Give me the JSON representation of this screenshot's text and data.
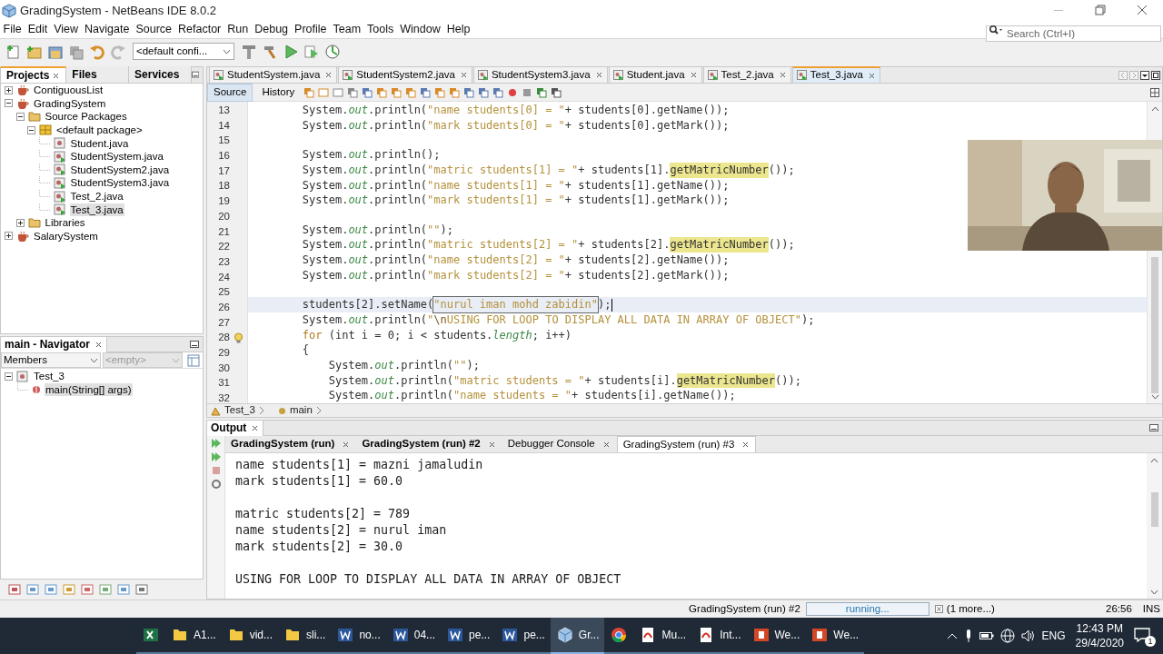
{
  "window": {
    "title": "GradingSystem - NetBeans IDE 8.0.2"
  },
  "menu": [
    "File",
    "Edit",
    "View",
    "Navigate",
    "Source",
    "Refactor",
    "Run",
    "Debug",
    "Profile",
    "Team",
    "Tools",
    "Window",
    "Help"
  ],
  "search": {
    "placeholder": "Search (Ctrl+I)"
  },
  "toolbar": {
    "configuration": "<default confi..."
  },
  "projects_panel": {
    "tabs": [
      {
        "label": "Projects",
        "selected": true
      },
      {
        "label": "Files",
        "selected": false
      },
      {
        "label": "Services",
        "selected": false
      }
    ],
    "tree": [
      {
        "label": "ContiguousList",
        "kind": "project",
        "expanded": false,
        "selected": false
      },
      {
        "label": "GradingSystem",
        "kind": "project",
        "expanded": true,
        "selected": false,
        "children": [
          {
            "label": "Source Packages",
            "kind": "folder",
            "expanded": true,
            "selected": false,
            "children": [
              {
                "label": "<default package>",
                "kind": "package",
                "expanded": true,
                "selected": false,
                "children": [
                  {
                    "label": "Student.java",
                    "kind": "class",
                    "selected": false
                  },
                  {
                    "label": "StudentSystem.java",
                    "kind": "main-class",
                    "selected": false
                  },
                  {
                    "label": "StudentSystem2.java",
                    "kind": "main-class",
                    "selected": false
                  },
                  {
                    "label": "StudentSystem3.java",
                    "kind": "main-class",
                    "selected": false
                  },
                  {
                    "label": "Test_2.java",
                    "kind": "main-class",
                    "selected": false
                  },
                  {
                    "label": "Test_3.java",
                    "kind": "main-class",
                    "selected": true
                  }
                ]
              }
            ]
          },
          {
            "label": "Libraries",
            "kind": "folder",
            "expanded": false,
            "selected": false
          }
        ]
      },
      {
        "label": "SalarySystem",
        "kind": "project",
        "expanded": false,
        "selected": false
      }
    ]
  },
  "navigator": {
    "title": "main - Navigator",
    "filter": "Members",
    "scope": "<empty>",
    "tree": [
      {
        "label": "Test_3",
        "kind": "class",
        "expanded": true,
        "selected": false,
        "children": [
          {
            "label": "main(String[] args)",
            "kind": "method",
            "selected": true
          }
        ]
      }
    ]
  },
  "editor": {
    "tabs": [
      {
        "label": "StudentSystem.java",
        "selected": false
      },
      {
        "label": "StudentSystem2.java",
        "selected": false
      },
      {
        "label": "StudentSystem3.java",
        "selected": false
      },
      {
        "label": "Student.java",
        "selected": false
      },
      {
        "label": "Test_2.java",
        "selected": false
      },
      {
        "label": "Test_3.java",
        "selected": true
      }
    ],
    "views": [
      {
        "label": "Source",
        "selected": true
      },
      {
        "label": "History",
        "selected": false
      }
    ],
    "lines": [
      {
        "number": "13",
        "current": false,
        "hint": false,
        "segments": [
          {
            "kind": "plain",
            "text": "        System."
          },
          {
            "kind": "field",
            "text": "out"
          },
          {
            "kind": "plain",
            "text": ".println("
          },
          {
            "kind": "string",
            "text": "\"name students[0] = \""
          },
          {
            "kind": "plain",
            "text": "+ students[0].getName());"
          }
        ]
      },
      {
        "number": "14",
        "current": false,
        "hint": false,
        "segments": [
          {
            "kind": "plain",
            "text": "        System."
          },
          {
            "kind": "field",
            "text": "out"
          },
          {
            "kind": "plain",
            "text": ".println("
          },
          {
            "kind": "string",
            "text": "\"mark students[0] = \""
          },
          {
            "kind": "plain",
            "text": "+ students[0].getMark());"
          }
        ]
      },
      {
        "number": "15",
        "current": false,
        "hint": false
      },
      {
        "number": "16",
        "current": false,
        "hint": false,
        "segments": [
          {
            "kind": "plain",
            "text": "        System."
          },
          {
            "kind": "field",
            "text": "out"
          },
          {
            "kind": "plain",
            "text": ".println();"
          }
        ]
      },
      {
        "number": "17",
        "current": false,
        "hint": false,
        "segments": [
          {
            "kind": "plain",
            "text": "        System."
          },
          {
            "kind": "field",
            "text": "out"
          },
          {
            "kind": "plain",
            "text": ".println("
          },
          {
            "kind": "string",
            "text": "\"matric students[1] = \""
          },
          {
            "kind": "plain",
            "text": "+ students[1]."
          },
          {
            "kind": "highlight",
            "text": "getMatricNumber"
          },
          {
            "kind": "plain",
            "text": "());"
          }
        ]
      },
      {
        "number": "18",
        "current": false,
        "hint": false,
        "segments": [
          {
            "kind": "plain",
            "text": "        System."
          },
          {
            "kind": "field",
            "text": "out"
          },
          {
            "kind": "plain",
            "text": ".println("
          },
          {
            "kind": "string",
            "text": "\"name students[1] = \""
          },
          {
            "kind": "plain",
            "text": "+ students[1].getName());"
          }
        ]
      },
      {
        "number": "19",
        "current": false,
        "hint": false,
        "segments": [
          {
            "kind": "plain",
            "text": "        System."
          },
          {
            "kind": "field",
            "text": "out"
          },
          {
            "kind": "plain",
            "text": ".println("
          },
          {
            "kind": "string",
            "text": "\"mark students[1] = \""
          },
          {
            "kind": "plain",
            "text": "+ students[1].getMark());"
          }
        ]
      },
      {
        "number": "20",
        "current": false,
        "hint": false
      },
      {
        "number": "21",
        "current": false,
        "hint": false,
        "segments": [
          {
            "kind": "plain",
            "text": "        System."
          },
          {
            "kind": "field",
            "text": "out"
          },
          {
            "kind": "plain",
            "text": ".println("
          },
          {
            "kind": "string",
            "text": "\"\""
          },
          {
            "kind": "plain",
            "text": ");"
          }
        ]
      },
      {
        "number": "22",
        "current": false,
        "hint": false,
        "segments": [
          {
            "kind": "plain",
            "text": "        System."
          },
          {
            "kind": "field",
            "text": "out"
          },
          {
            "kind": "plain",
            "text": ".println("
          },
          {
            "kind": "string",
            "text": "\"matric students[2] = \""
          },
          {
            "kind": "plain",
            "text": "+ students[2]."
          },
          {
            "kind": "highlight",
            "text": "getMatricNumber"
          },
          {
            "kind": "plain",
            "text": "());"
          }
        ]
      },
      {
        "number": "23",
        "current": false,
        "hint": false,
        "segments": [
          {
            "kind": "plain",
            "text": "        System."
          },
          {
            "kind": "field",
            "text": "out"
          },
          {
            "kind": "plain",
            "text": ".println("
          },
          {
            "kind": "string",
            "text": "\"name students[2] = \""
          },
          {
            "kind": "plain",
            "text": "+ students[2].getName());"
          }
        ]
      },
      {
        "number": "24",
        "current": false,
        "hint": false,
        "segments": [
          {
            "kind": "plain",
            "text": "        System."
          },
          {
            "kind": "field",
            "text": "out"
          },
          {
            "kind": "plain",
            "text": ".println("
          },
          {
            "kind": "string",
            "text": "\"mark students[2] = \""
          },
          {
            "kind": "plain",
            "text": "+ students[2].getMark());"
          }
        ]
      },
      {
        "number": "25",
        "current": false,
        "hint": false
      },
      {
        "number": "26",
        "current": true,
        "hint": false,
        "segments": [
          {
            "kind": "plain",
            "text": "        students[2].setName("
          },
          {
            "kind": "boxed",
            "text": "\"nurul iman mohd zabidin\""
          },
          {
            "kind": "plain",
            "text": ");"
          }
        ]
      },
      {
        "number": "27",
        "current": false,
        "hint": false,
        "segments": [
          {
            "kind": "plain",
            "text": "        System."
          },
          {
            "kind": "field",
            "text": "out"
          },
          {
            "kind": "plain",
            "text": ".println("
          },
          {
            "kind": "string",
            "text": "\""
          },
          {
            "kind": "escape",
            "text": "\\n"
          },
          {
            "kind": "string",
            "text": "USING FOR LOOP TO DISPLAY ALL DATA IN ARRAY OF OBJECT\""
          },
          {
            "kind": "plain",
            "text": ");"
          }
        ]
      },
      {
        "number": "28",
        "current": false,
        "hint": true,
        "segments": [
          {
            "kind": "keyword",
            "text": "        for"
          },
          {
            "kind": "plain",
            "text": " (int i = 0; i < students."
          },
          {
            "kind": "field",
            "text": "length"
          },
          {
            "kind": "plain",
            "text": "; i++)"
          }
        ]
      },
      {
        "number": "29",
        "current": false,
        "hint": false,
        "segments": [
          {
            "kind": "plain",
            "text": "        {"
          }
        ]
      },
      {
        "number": "30",
        "current": false,
        "hint": false,
        "segments": [
          {
            "kind": "plain",
            "text": "            System."
          },
          {
            "kind": "field",
            "text": "out"
          },
          {
            "kind": "plain",
            "text": ".println("
          },
          {
            "kind": "string",
            "text": "\"\""
          },
          {
            "kind": "plain",
            "text": ");"
          }
        ]
      },
      {
        "number": "31",
        "current": false,
        "hint": false,
        "segments": [
          {
            "kind": "plain",
            "text": "            System."
          },
          {
            "kind": "field",
            "text": "out"
          },
          {
            "kind": "plain",
            "text": ".println("
          },
          {
            "kind": "string",
            "text": "\"matric students = \""
          },
          {
            "kind": "plain",
            "text": "+ students[i]."
          },
          {
            "kind": "highlight",
            "text": "getMatricNumber"
          },
          {
            "kind": "plain",
            "text": "());"
          }
        ]
      },
      {
        "number": "32",
        "current": false,
        "hint": false,
        "segments": [
          {
            "kind": "plain",
            "text": "            System."
          },
          {
            "kind": "field",
            "text": "out"
          },
          {
            "kind": "plain",
            "text": ".println("
          },
          {
            "kind": "string",
            "text": "\"name students = \""
          },
          {
            "kind": "plain",
            "text": "+ students[i].getName());"
          }
        ]
      }
    ],
    "breadcrumb": [
      "Test_3",
      "main"
    ]
  },
  "webcam": {
    "kind": "picture"
  },
  "output": {
    "title": "Output",
    "tabs": [
      {
        "label": "GradingSystem (run)",
        "selected": false,
        "running": true
      },
      {
        "label": "GradingSystem (run) #2",
        "selected": false,
        "running": true
      },
      {
        "label": "Debugger Console",
        "selected": false,
        "running": false
      },
      {
        "label": "GradingSystem (run) #3",
        "selected": true,
        "running": false
      }
    ],
    "blocks": [
      [
        "name students[1] = mazni jamaludin",
        "mark students[1] = 60.0"
      ],
      [
        "matric students[2] = 789",
        "name students[2] = nurul iman",
        "mark students[2] = 30.0"
      ],
      [
        "USING FOR LOOP TO DISPLAY ALL DATA IN ARRAY OF OBJECT"
      ]
    ]
  },
  "status_bar": {
    "process": "GradingSystem (run) #2",
    "progress": "running...",
    "more": "(1 more...)",
    "position": "26:56",
    "mode": "INS"
  },
  "taskbar": {
    "apps": [
      {
        "kind": "excel",
        "active": false
      },
      {
        "kind": "folder",
        "label": "A1...",
        "active": false
      },
      {
        "kind": "folder",
        "label": "vid...",
        "active": false
      },
      {
        "kind": "folder",
        "label": "sli...",
        "active": false
      },
      {
        "kind": "word",
        "label": "no...",
        "active": false
      },
      {
        "kind": "word",
        "label": "04...",
        "active": false
      },
      {
        "kind": "word",
        "label": "pe...",
        "active": false
      },
      {
        "kind": "word",
        "label": "pe...",
        "active": false
      },
      {
        "kind": "netbeans",
        "label": "Gr...",
        "active": true
      },
      {
        "kind": "chrome",
        "active": false
      },
      {
        "kind": "pdf",
        "label": "Mu...",
        "active": false
      },
      {
        "kind": "pdf",
        "label": "Int...",
        "active": false
      },
      {
        "kind": "powerpoint",
        "label": "We...",
        "active": false
      },
      {
        "kind": "powerpoint",
        "label": "We...",
        "active": false
      }
    ],
    "language": "ENG",
    "time": "12:43 PM",
    "date": "29/4/2020",
    "notifications": "1"
  }
}
